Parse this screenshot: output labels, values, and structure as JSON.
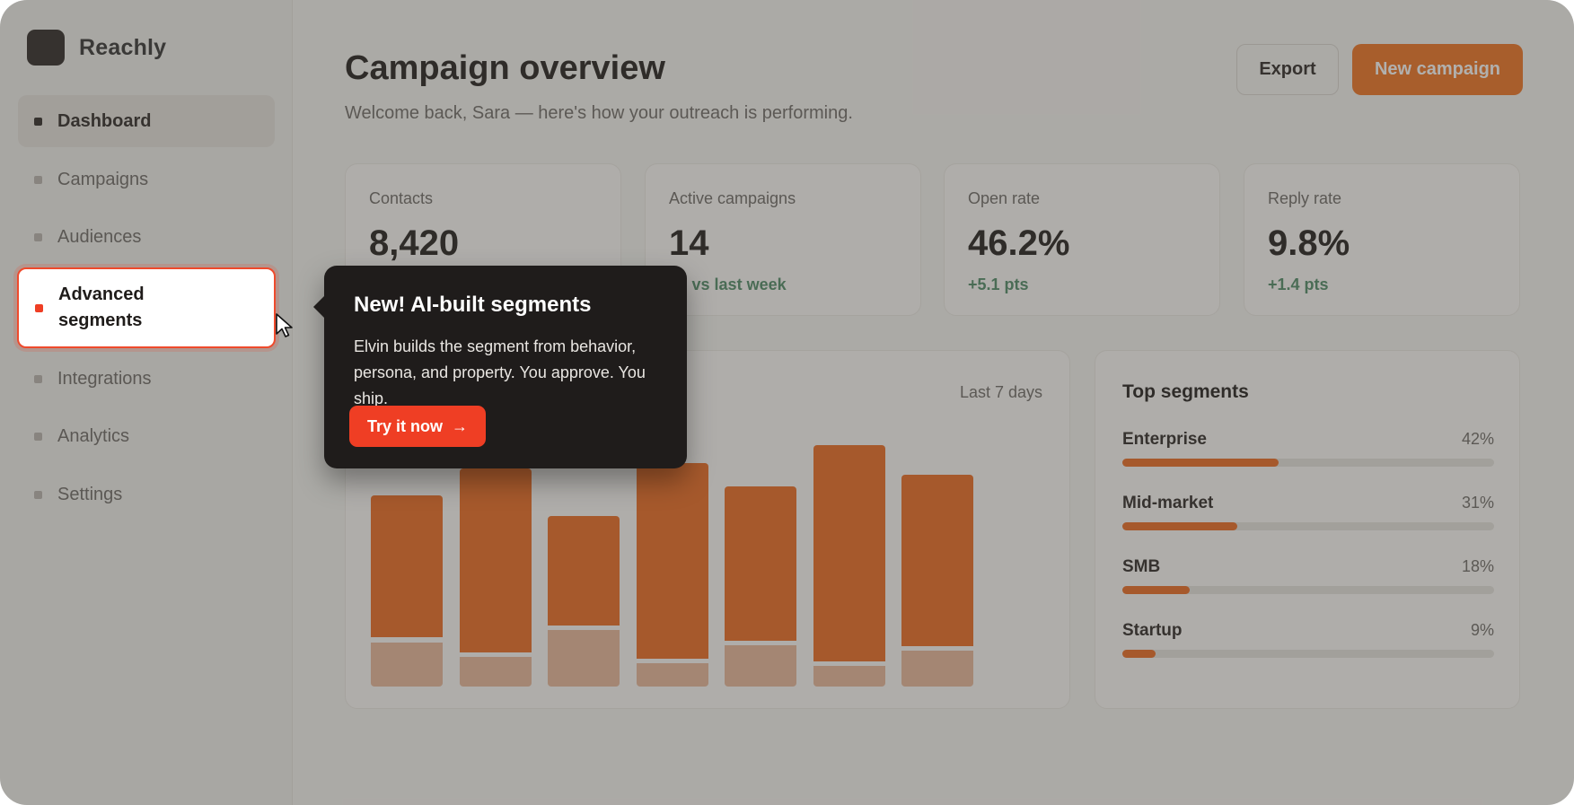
{
  "app": {
    "name": "Reachly"
  },
  "sidebar": {
    "items": [
      {
        "label": "Dashboard"
      },
      {
        "label": "Campaigns"
      },
      {
        "label": "Audiences"
      },
      {
        "label": "Advanced segments"
      },
      {
        "label": "Integrations"
      },
      {
        "label": "Analytics"
      },
      {
        "label": "Settings"
      }
    ]
  },
  "header": {
    "title": "Campaign overview",
    "subtitle": "Welcome back, Sara — here's how your outreach is performing.",
    "export_label": "Export",
    "new_campaign_label": "New campaign"
  },
  "stats": [
    {
      "label": "Contacts",
      "value": "8,420",
      "delta": ""
    },
    {
      "label": "Active campaigns",
      "value": "14",
      "delta": "+3 vs last week"
    },
    {
      "label": "Open rate",
      "value": "46.2%",
      "delta": "+5.1 pts"
    },
    {
      "label": "Reply rate",
      "value": "9.8%",
      "delta": "+1.4 pts"
    }
  ],
  "chart": {
    "range_label": "Last 7 days"
  },
  "chart_data": {
    "type": "bar",
    "categories": [
      "",
      "",
      "",
      "",
      "",
      "",
      ""
    ],
    "series": [
      {
        "name": "",
        "values": [
          48,
          62,
          37,
          66,
          52,
          73,
          58
        ]
      },
      {
        "name": "",
        "values": [
          15,
          10,
          19,
          8,
          14,
          7,
          12
        ]
      }
    ],
    "stacked": true,
    "ylim": [
      0,
      100
    ],
    "grid": false,
    "legend": "none"
  },
  "segments": {
    "title": "Top segments",
    "items": [
      {
        "name": "Enterprise",
        "pct": "42%",
        "value": 42
      },
      {
        "name": "Mid-market",
        "pct": "31%",
        "value": 31
      },
      {
        "name": "SMB",
        "pct": "18%",
        "value": 18
      },
      {
        "name": "Startup",
        "pct": "9%",
        "value": 9
      }
    ]
  },
  "tooltip": {
    "title": "New! AI-built segments",
    "body": "Elvin builds the segment from behavior, persona, and property. You approve. You ship.",
    "button_label": "Try it now",
    "button_icon": "arrow-right-icon"
  },
  "colors": {
    "accent": "#f07220",
    "highlight": "#ef3e24",
    "tooltip_bg": "#1f1c1b"
  }
}
